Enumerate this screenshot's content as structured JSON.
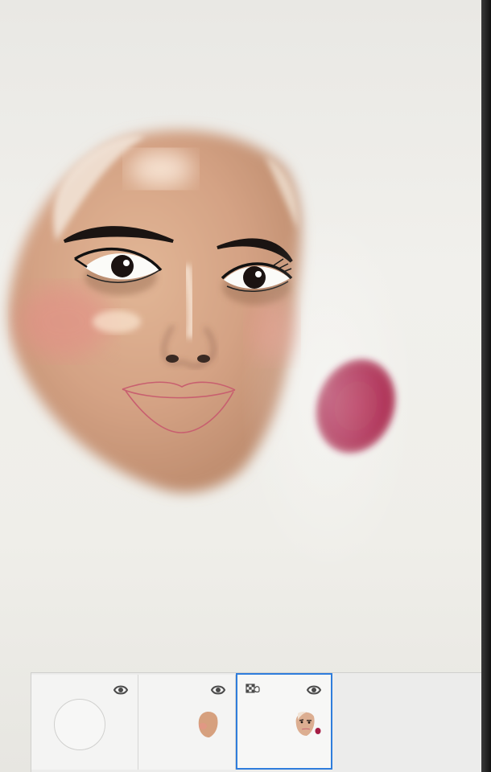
{
  "app": {
    "name": "drawing-app"
  },
  "canvas": {
    "background": "#f0efeb",
    "skin_color": "#d9a98a",
    "blush_color": "#e49a8e",
    "lip_line_color": "#c85f6f",
    "swatch_color": "#a81e45"
  },
  "layers_panel": {
    "layers": [
      {
        "id": "layer-1",
        "visible": true,
        "selected": false,
        "thumbnail": "empty-circle"
      },
      {
        "id": "layer-2",
        "visible": true,
        "selected": false,
        "thumbnail": "face-base"
      },
      {
        "id": "layer-3",
        "visible": true,
        "selected": true,
        "alpha_locked": true,
        "thumbnail": "face-detailed-with-swatch"
      }
    ],
    "selected_color": "#2f7ddc",
    "icons": {
      "visibility": "eye-icon",
      "alpha_lock": "alpha-lock-icon"
    }
  }
}
